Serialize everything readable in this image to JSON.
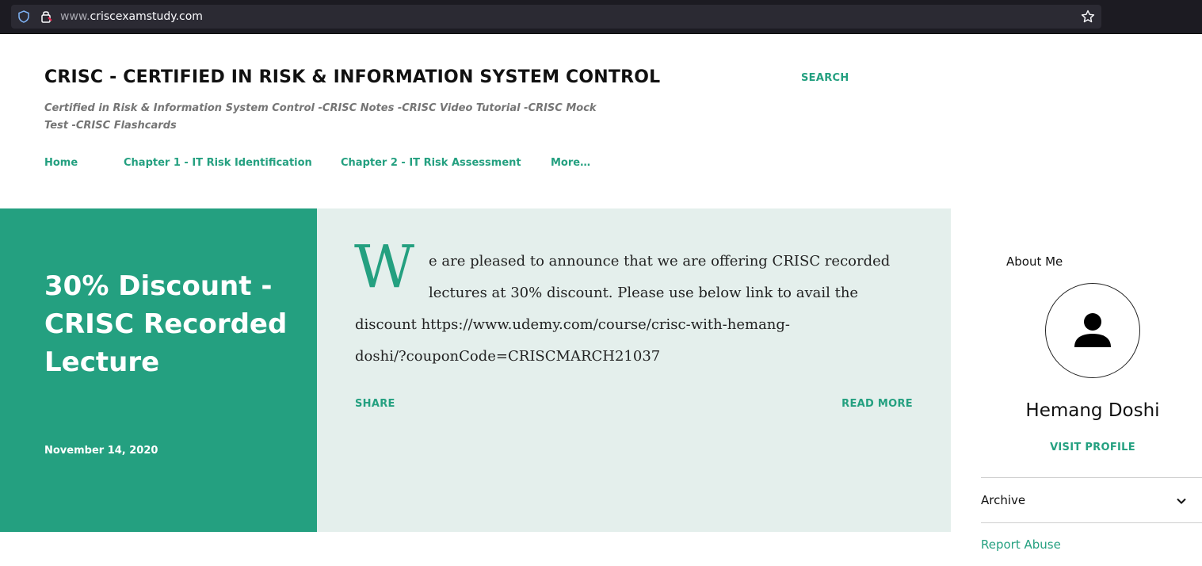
{
  "browser": {
    "url_prefix": "www.",
    "url_domain": "criscexamstudy.com"
  },
  "header": {
    "title": "CRISC - CERTIFIED IN RISK & INFORMATION SYSTEM CONTROL",
    "description": "Certified in Risk & Information System Control -CRISC Notes -CRISC Video Tutorial -CRISC Mock Test -CRISC Flashcards",
    "search_label": "SEARCH"
  },
  "nav": {
    "items": [
      {
        "label": "Home"
      },
      {
        "label": "Chapter 1 - IT Risk Identification"
      },
      {
        "label": "Chapter 2 - IT Risk Assessment"
      },
      {
        "label": "More…"
      }
    ]
  },
  "post": {
    "title": "30% Discount - CRISC Recorded Lecture",
    "date": "November 14, 2020",
    "dropcap": "W",
    "snippet_lines": [
      "e are pleased to announce that we are offering CRISC recorded",
      "lectures at 30% discount. Please use below link to avail the",
      "discount https://www.udemy.com/course/crisc-with-hemang-",
      "doshi/?couponCode=CRISCMARCH21037"
    ],
    "share_label": "SHARE",
    "read_more_label": "READ MORE"
  },
  "sidebar": {
    "about_title": "About Me",
    "profile_name": "Hemang Doshi",
    "visit_profile_label": "VISIT PROFILE",
    "archive_label": "Archive",
    "report_abuse_label": "Report Abuse"
  },
  "colors": {
    "accent": "#24a080",
    "hero_panel": "#e4efec",
    "browser_chrome": "#1c1b22"
  },
  "icons": [
    "shield-icon",
    "lock-icon",
    "star-icon",
    "person-icon",
    "chevron-down-icon"
  ]
}
